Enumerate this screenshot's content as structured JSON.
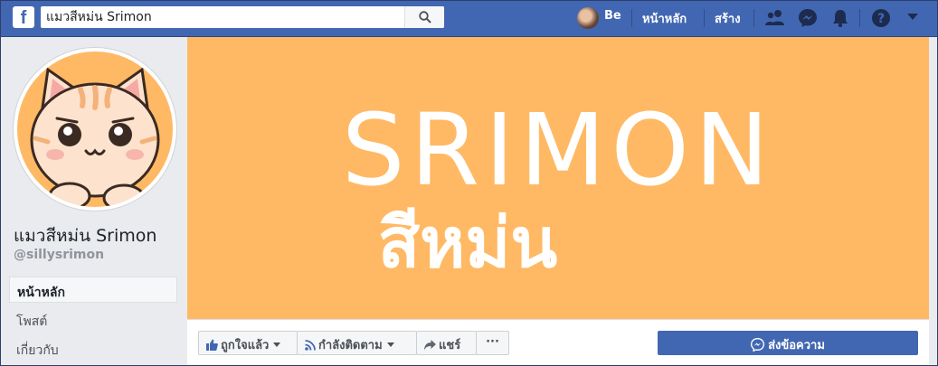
{
  "topbar": {
    "logo_letter": "f",
    "search": {
      "value": "แมวสีหม่น Srimon",
      "placeholder": ""
    },
    "profile_name": "Be",
    "home_label": "หน้าหลัก",
    "create_label": "สร้าง",
    "icons": [
      "friends-icon",
      "messenger-icon",
      "notifications-icon",
      "help-icon",
      "chevron-down-icon"
    ],
    "brand_color": "#4267b2"
  },
  "page": {
    "name": "แมวสีหม่น Srimon",
    "handle": "@sillysrimon",
    "nav": [
      {
        "label": "หน้าหลัก",
        "active": true
      },
      {
        "label": "โพสต์",
        "active": false
      },
      {
        "label": "เกี่ยวกับ",
        "active": false
      }
    ]
  },
  "cover": {
    "title": "SRIMON",
    "subtitle": "สีหม่น",
    "background_color": "#ffb964"
  },
  "actions": {
    "like_label": "ถูกใจแล้ว",
    "follow_label": "กำลังติดตาม",
    "share_label": "แชร์",
    "more_label": "···",
    "message_label": "ส่งข้อความ"
  }
}
